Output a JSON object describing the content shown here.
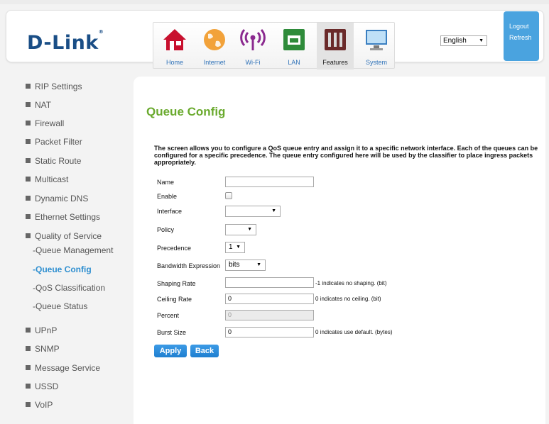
{
  "brand": {
    "logo": "D-Link",
    "reg": "®"
  },
  "nav": {
    "items": [
      {
        "label": "Home",
        "icon": "home-icon"
      },
      {
        "label": "Internet",
        "icon": "globe-icon"
      },
      {
        "label": "Wi-Fi",
        "icon": "wifi-icon"
      },
      {
        "label": "LAN",
        "icon": "lan-icon"
      },
      {
        "label": "Features",
        "icon": "features-icon"
      },
      {
        "label": "System",
        "icon": "monitor-icon"
      }
    ],
    "active": "Features"
  },
  "language": {
    "selected": "English"
  },
  "account": {
    "logout": "Logout",
    "refresh": "Refresh"
  },
  "sidebar": {
    "items": [
      {
        "label": "RIP Settings"
      },
      {
        "label": "NAT"
      },
      {
        "label": "Firewall"
      },
      {
        "label": "Packet Filter"
      },
      {
        "label": "Static Route"
      },
      {
        "label": "Multicast"
      },
      {
        "label": "Dynamic DNS"
      },
      {
        "label": "Ethernet Settings"
      },
      {
        "label": "Quality of Service"
      },
      {
        "label": "UPnP"
      },
      {
        "label": "SNMP"
      },
      {
        "label": "Message Service"
      },
      {
        "label": "USSD"
      },
      {
        "label": "VoIP"
      }
    ],
    "qos_subitems": [
      {
        "label": "-Queue Management"
      },
      {
        "label": "-Queue Config"
      },
      {
        "label": "-QoS Classification"
      },
      {
        "label": "-Queue Status"
      }
    ],
    "active_sub": "-Queue Config"
  },
  "page": {
    "title": "Queue Config",
    "description": "The screen allows you to configure a QoS queue entry and assign it to a specific network interface. Each of the queues can be configured for a specific precedence. The queue entry configured here will be used by the classifier to place ingress packets appropriately."
  },
  "form": {
    "name": {
      "label": "Name",
      "value": ""
    },
    "enable": {
      "label": "Enable",
      "checked": false
    },
    "interface": {
      "label": "Interface",
      "value": ""
    },
    "policy": {
      "label": "Policy",
      "value": ""
    },
    "precedence": {
      "label": "Precedence",
      "value": "1"
    },
    "bandwidth_expression": {
      "label": "Bandwidth Expression",
      "value": "bits"
    },
    "shaping_rate": {
      "label": "Shaping Rate",
      "value": "",
      "hint": "-1 indicates no shaping. (bit)"
    },
    "ceiling_rate": {
      "label": "Ceiling Rate",
      "value": "0",
      "hint": "0 indicates no ceiling. (bit)"
    },
    "percent": {
      "label": "Percent",
      "value": "0"
    },
    "burst_size": {
      "label": "Burst Size",
      "value": "0",
      "hint": "0 indicates use default. (bytes)"
    }
  },
  "buttons": {
    "apply": "Apply",
    "back": "Back"
  },
  "colors": {
    "brand_blue": "#1a4e86",
    "title_green": "#6aaa2e",
    "accent_blue": "#2f8fd0",
    "button_blue": "#2a8be0"
  }
}
